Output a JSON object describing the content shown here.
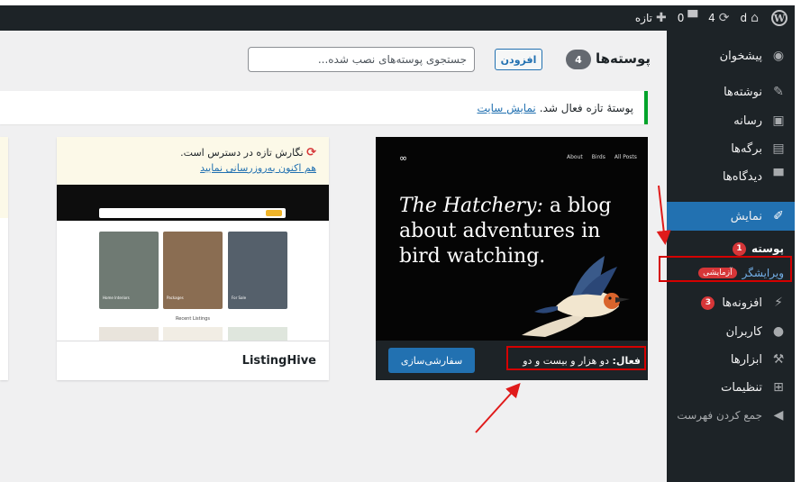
{
  "admin_bar": {
    "wp_logo": "W",
    "home_icon": "home-icon",
    "site_name": "d",
    "updates_count": "4",
    "comments_count": "0",
    "new_label": "تازه"
  },
  "sidebar": {
    "dashboard": "پیشخوان",
    "posts": "نوشته‌ها",
    "media": "رسانه",
    "pages": "برگه‌ها",
    "comments": "دیدگاه‌ها",
    "appearance": "نمایش",
    "themes": "پوسته",
    "themes_badge": "1",
    "editor": "ویرایشگر",
    "editor_badge": "آزمایشی",
    "plugins": "افزونه‌ها",
    "plugins_badge": "3",
    "users": "کاربران",
    "tools": "ابزارها",
    "settings": "تنظیمات",
    "collapse": "جمع کردن فهرست"
  },
  "header": {
    "title": "پوسته‌ها",
    "count": "4",
    "add_new": "افزودن",
    "search_placeholder": "جستجوی پوسته‌های نصب شده..."
  },
  "notice": {
    "text": "پوستهٔ تازه فعال شد.",
    "link": "نمایش سایت"
  },
  "active_theme": {
    "screenshot_title": "The Hatchery:",
    "screenshot_rest": " a blog about adventures in bird watching.",
    "nav": [
      "About",
      "Birds",
      "All Posts"
    ],
    "active_prefix": "فعال:",
    "active_name": "دو هزار و بیست و دو",
    "customize": "سفارشی‌سازی"
  },
  "theme_2": {
    "update_text": "نگارش تازه در دسترس است.",
    "update_link": "هم اکنون به‌روزرسانی نمایید",
    "screenshot_recent": "Recent Listings",
    "categories": [
      "Home Interiors",
      "Packages",
      "For Sale"
    ],
    "name": "ListingHive"
  }
}
